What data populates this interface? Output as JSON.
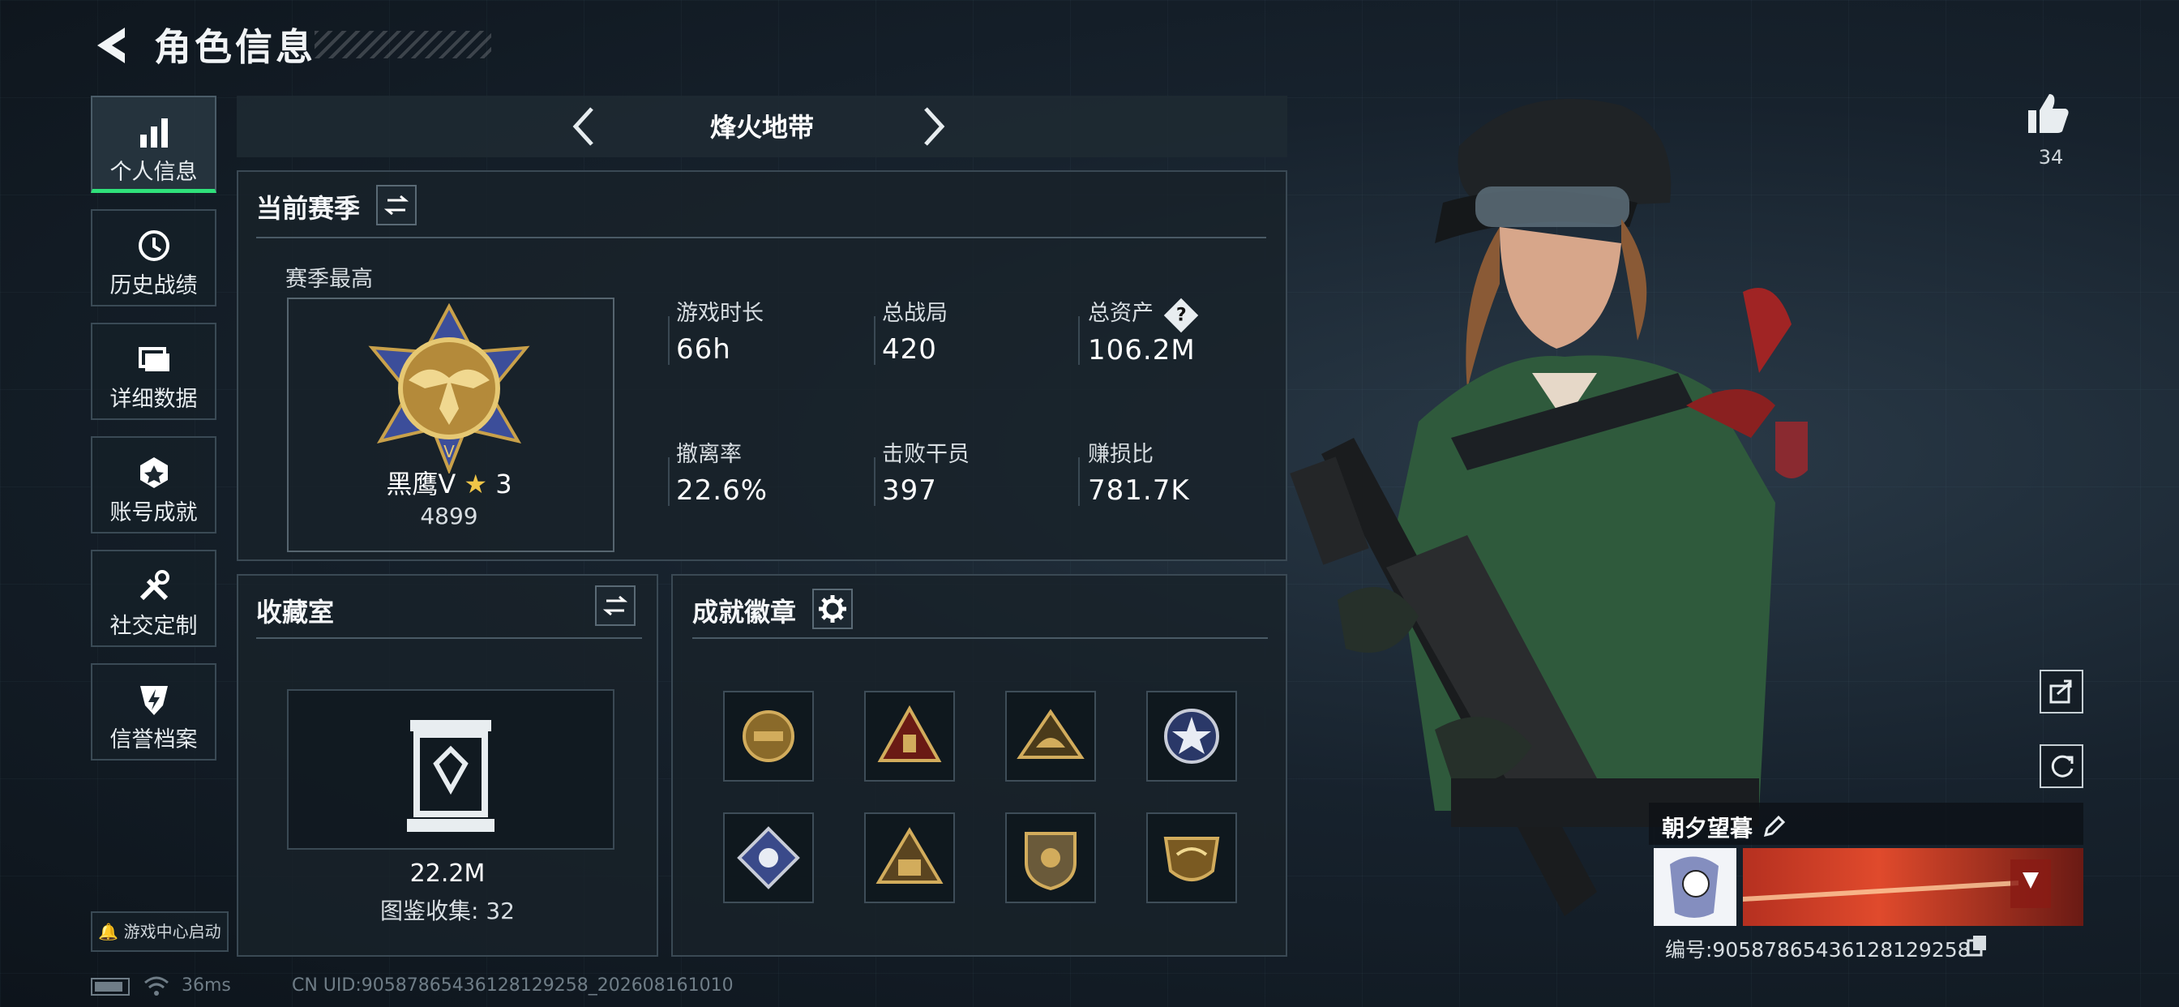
{
  "header": {
    "title": "角色信息"
  },
  "sidebar": {
    "items": [
      {
        "label": "个人信息",
        "icon": "bar-chart-icon",
        "active": true
      },
      {
        "label": "历史战绩",
        "icon": "history-clock-icon",
        "active": false
      },
      {
        "label": "详细数据",
        "icon": "folder-icon",
        "active": false
      },
      {
        "label": "账号成就",
        "icon": "medal-icon",
        "active": false
      },
      {
        "label": "社交定制",
        "icon": "tools-icon",
        "active": false
      },
      {
        "label": "信誉档案",
        "icon": "shield-lightning-icon",
        "active": false
      }
    ],
    "game_center": "游戏中心启动"
  },
  "mode_nav": {
    "title": "烽火地带"
  },
  "season": {
    "title": "当前赛季",
    "best_label": "赛季最高",
    "rank_name": "黑鹰V",
    "rank_stars": "3",
    "rank_points": "4899",
    "stats": [
      {
        "label": "游戏时长",
        "value": "66h"
      },
      {
        "label": "总战局",
        "value": "420"
      },
      {
        "label": "总资产",
        "value": "106.2M",
        "help": "?"
      },
      {
        "label": "撤离率",
        "value": "22.6%"
      },
      {
        "label": "击败干员",
        "value": "397"
      },
      {
        "label": "赚损比",
        "value": "781.7K"
      }
    ]
  },
  "collection": {
    "title": "收藏室",
    "value": "22.2M",
    "gallery_label": "图鉴收集: 32"
  },
  "achievements": {
    "title": "成就徽章",
    "badges": [
      "shield-badge-icon",
      "triangle-badge-icon",
      "triangle-badge-icon",
      "star-badge-icon",
      "diamond-badge-icon",
      "triangle-badge-icon",
      "shield-badge-icon",
      "shield-badge-icon"
    ]
  },
  "status_bar": {
    "ping": "36ms",
    "uid": "CN UID:9058786543612812925­8_202608161010"
  },
  "player": {
    "likes": "34",
    "name": "朝夕望暮",
    "id_label": "编号:9058786543612812925­8"
  },
  "colors": {
    "accent_green": "#2fe07a",
    "panel_border": "#3a4954",
    "gold": "#c9a14a"
  }
}
